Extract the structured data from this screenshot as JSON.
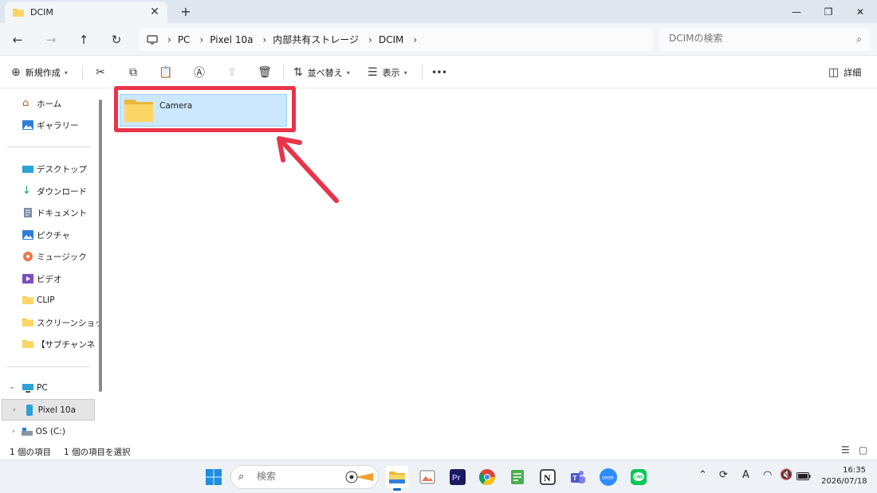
{
  "tab": {
    "title": "DCIM",
    "close": "✕",
    "new": "+"
  },
  "window": {
    "minimize": "—",
    "maximize": "❐",
    "close": "✕"
  },
  "nav": {
    "back": "←",
    "forward": "→",
    "up": "↑",
    "refresh": "↻"
  },
  "breadcrumb": [
    "PC",
    "Pixel 10a",
    "内部共有ストレージ",
    "DCIM"
  ],
  "search": {
    "placeholder": "DCIMの検索"
  },
  "toolbar": {
    "new_label": "新規作成",
    "sort_label": "並べ替え",
    "view_label": "表示",
    "more_label": "•••",
    "details_label": "詳細"
  },
  "sidebar": {
    "home": "ホーム",
    "gallery": "ギャラリー",
    "quick": [
      {
        "label": "デスクトップ",
        "icon": "desktop-icon",
        "pinned": true
      },
      {
        "label": "ダウンロード",
        "icon": "download-icon",
        "pinned": true
      },
      {
        "label": "ドキュメント",
        "icon": "document-icon",
        "pinned": true
      },
      {
        "label": "ピクチャ",
        "icon": "pictures-icon",
        "pinned": true
      },
      {
        "label": "ミュージック",
        "icon": "music-icon",
        "pinned": true
      },
      {
        "label": "ビデオ",
        "icon": "video-icon",
        "pinned": true
      },
      {
        "label": "CLIP",
        "icon": "folder-icon",
        "pinned": true
      },
      {
        "label": "スクリーンショット",
        "icon": "folder-icon",
        "pinned": false
      },
      {
        "label": "【サブチャンネル素材",
        "icon": "folder-icon",
        "pinned": false
      }
    ],
    "pc": "PC",
    "pixel": "Pixel 10a",
    "os": "OS (C:)"
  },
  "content": {
    "items": [
      {
        "name": "Camera",
        "type": "folder"
      }
    ]
  },
  "status": {
    "count": "1 個の項目",
    "selected": "1 個の項目を選択"
  },
  "taskbar": {
    "search_placeholder": "検索",
    "time": "16:35",
    "date": "2026/07/18",
    "ime": "A"
  },
  "colors": {
    "highlight": "#e8344a",
    "selection": "#cce8ff",
    "accent": "#0067c0",
    "folder": "#f7c948"
  }
}
